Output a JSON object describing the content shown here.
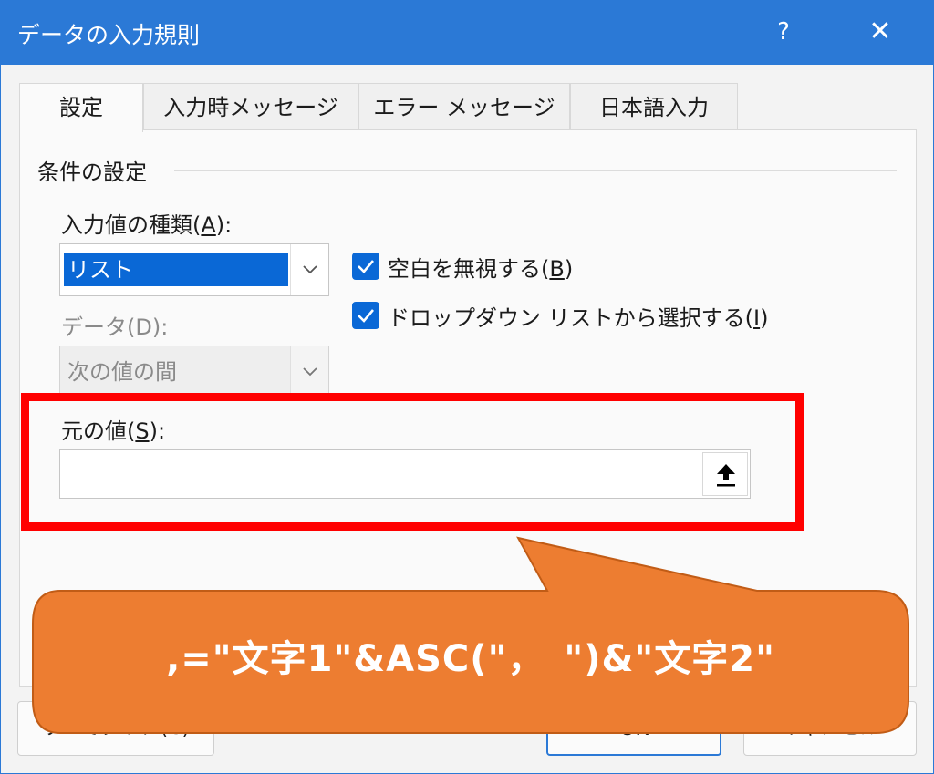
{
  "window": {
    "title": "データの入力規則",
    "help_label": "?",
    "close_label": "✕"
  },
  "tabs": [
    {
      "label": "設定",
      "active": true
    },
    {
      "label": "入力時メッセージ",
      "active": false
    },
    {
      "label": "エラー メッセージ",
      "active": false
    },
    {
      "label": "日本語入力",
      "active": false
    }
  ],
  "settings": {
    "group_title": "条件の設定",
    "allow": {
      "label": "入力値の種類",
      "accesskey": "A",
      "value": "リスト"
    },
    "data": {
      "label": "データ",
      "accesskey": "D",
      "value": "次の値の間",
      "disabled": true
    },
    "ignore_blank": {
      "label": "空白を無視する",
      "accesskey": "B",
      "checked": true
    },
    "in_cell_dropdown": {
      "label": "ドロップダウン リストから選択する",
      "accesskey": "I",
      "checked": true
    },
    "source": {
      "label": "元の値",
      "accesskey": "S",
      "value": ""
    }
  },
  "buttons": {
    "clear_all": "すべてクリア(C)",
    "ok": "OK",
    "cancel": "キャンセル"
  },
  "annotation": {
    "text": ",=\"文字1\"&ASC(\"，　\")&\"文字2\"",
    "highlight_color": "#ff0000",
    "callout_color": "#ed7d31"
  },
  "colors": {
    "titlebar": "#2b79d6",
    "accent": "#0a68d6"
  }
}
